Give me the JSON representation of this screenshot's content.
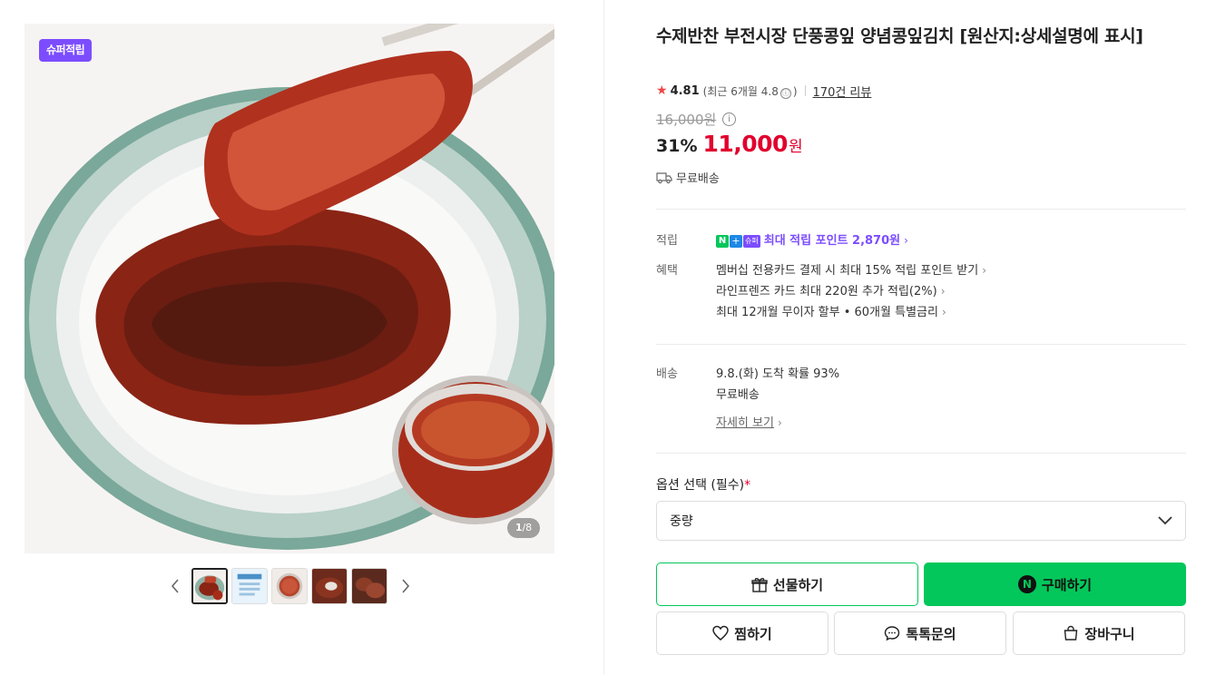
{
  "gallery": {
    "badge": "슈퍼적립",
    "counter_current": "1",
    "counter_total": "/8",
    "thumbnail_count": 5
  },
  "product": {
    "title": "수제반찬 부전시장 단풍콩잎 양념콩잎김치 [원산지:상세설명에 표시]",
    "rating_score": "4.81",
    "rating_recent_prefix": "(최근 6개월 4.8",
    "rating_recent_suffix": ")",
    "rating_info_icon": "ⓘ",
    "reviews": "170건 리뷰",
    "original_price": "16,000원",
    "discount": "31%",
    "price": "11,000",
    "currency": "원",
    "free_shipping": "무료배송"
  },
  "benefits": {
    "points_label": "적립",
    "points_badge_n": "N",
    "points_badge_plus": "+",
    "points_badge_super": "슈퍼",
    "points_text": "최대 적립 포인트 2,870원",
    "perks_label": "혜택",
    "perks": [
      "멤버십 전용카드 결제 시 최대 15% 적립 포인트 받기",
      "라인프렌즈 카드 최대 220원 추가 적립(2%)",
      "최대 12개월 무이자 할부 • 60개월 특별금리"
    ]
  },
  "delivery": {
    "label": "배송",
    "arrival": "9.8.(화) 도착 확률 93%",
    "fee": "무료배송",
    "detail_link": "자세히 보기"
  },
  "options": {
    "label": "옵션 선택 (필수)",
    "required_mark": "*",
    "selected": "중량"
  },
  "actions": {
    "gift": "선물하기",
    "buy": "구매하기",
    "buy_badge": "N",
    "wish": "찜하기",
    "talk": "톡톡문의",
    "cart": "장바구니"
  },
  "colors": {
    "brand_green": "#03c75a",
    "price_red": "#e1002d",
    "super_purple": "#7c4dff"
  }
}
